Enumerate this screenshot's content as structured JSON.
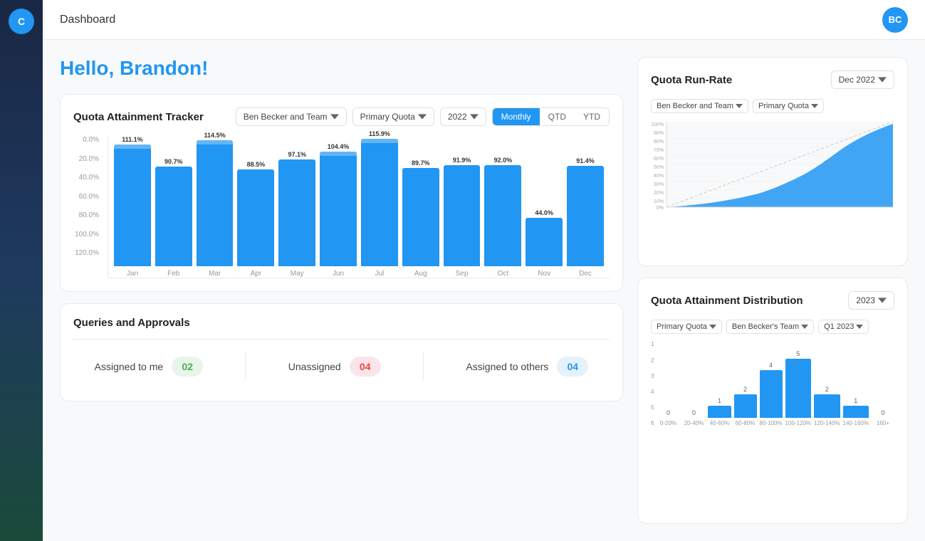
{
  "app": {
    "sidebar_logo": "C",
    "header_title": "Dashboard",
    "user_initials": "BC"
  },
  "greeting": {
    "text": "Hello, Brandon!"
  },
  "quota_tracker": {
    "title": "Quota Attainment Tracker",
    "filter_team": "Ben Becker and Team",
    "filter_quota": "Primary Quota",
    "filter_year": "2022",
    "tab_monthly": "Monthly",
    "tab_qtd": "QTD",
    "tab_ytd": "YTD",
    "active_tab": "Monthly",
    "y_labels": [
      "0.0%",
      "20.0%",
      "40.0%",
      "60.0%",
      "80.0%",
      "100.0%",
      "120.0%"
    ],
    "bars": [
      {
        "month": "Jan",
        "value": 111.1,
        "pct": "111.1%",
        "height_pct": 92.5
      },
      {
        "month": "Feb",
        "value": 90.7,
        "pct": "90.7%",
        "height_pct": 75.6
      },
      {
        "month": "Mar",
        "value": 114.5,
        "pct": "114.5%",
        "height_pct": 95.4
      },
      {
        "month": "Apr",
        "value": 88.5,
        "pct": "88.5%",
        "height_pct": 73.8
      },
      {
        "month": "May",
        "value": 97.1,
        "pct": "97.1%",
        "height_pct": 80.9
      },
      {
        "month": "Jun",
        "value": 104.4,
        "pct": "104.4%",
        "height_pct": 87.0
      },
      {
        "month": "Jul",
        "value": 115.9,
        "pct": "115.9%",
        "height_pct": 96.6
      },
      {
        "month": "Aug",
        "value": 89.7,
        "pct": "89.7%",
        "height_pct": 74.8
      },
      {
        "month": "Sep",
        "value": 91.9,
        "pct": "91.9%",
        "height_pct": 76.6
      },
      {
        "month": "Oct",
        "value": 92.0,
        "pct": "92.0%",
        "height_pct": 76.7
      },
      {
        "month": "Nov",
        "value": 44.0,
        "pct": "44.0%",
        "height_pct": 36.7
      },
      {
        "month": "Dec",
        "value": 91.4,
        "pct": "91.4%",
        "height_pct": 76.2
      }
    ]
  },
  "queries": {
    "title": "Queries and Approvals",
    "assigned_me_label": "Assigned to me",
    "assigned_me_value": "02",
    "unassigned_label": "Unassigned",
    "unassigned_value": "04",
    "assigned_others_label": "Assigned to others",
    "assigned_others_value": "04"
  },
  "run_rate": {
    "title": "Quota Run-Rate",
    "filter_date": "Dec 2022",
    "filter_team": "Ben Becker and Team",
    "filter_quota": "Primary Quota",
    "y_labels": [
      "100%",
      "90%",
      "80%",
      "70%",
      "60%",
      "50%",
      "40%",
      "30%",
      "20%",
      "10%",
      "0%"
    ]
  },
  "distribution": {
    "title": "Quota Attainment Distribution",
    "filter_year": "2023",
    "filter_quota": "Primary Quota",
    "filter_team": "Ben Becker's Team",
    "filter_period": "Q1 2023",
    "y_labels": [
      "6",
      "5",
      "4",
      "3",
      "2",
      "1"
    ],
    "bars": [
      {
        "label": "0-20%",
        "value": 0
      },
      {
        "label": "20-40%",
        "value": 0
      },
      {
        "label": "40-60%",
        "value": 1
      },
      {
        "label": "60-80%",
        "value": 2
      },
      {
        "label": "80-100%",
        "value": 4
      },
      {
        "label": "100-120%",
        "value": 5
      },
      {
        "label": "120-140%",
        "value": 2
      },
      {
        "label": "140-160%",
        "value": 1
      },
      {
        "label": "160+",
        "value": 0
      }
    ],
    "max_value": 6
  }
}
